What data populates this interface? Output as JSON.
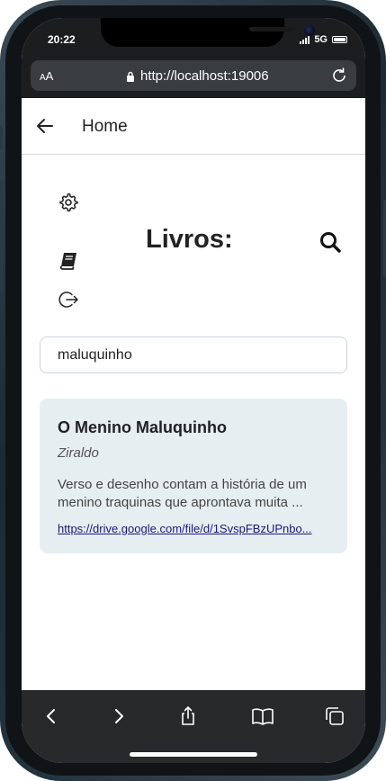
{
  "status_bar": {
    "time": "20:22",
    "network": "5G"
  },
  "browser": {
    "text_size_label_small": "A",
    "text_size_label_large": "A",
    "url": "http://localhost:19006"
  },
  "app_bar": {
    "title": "Home"
  },
  "page": {
    "heading": "Livros:",
    "icons": [
      "gear-icon",
      "book-icon",
      "logout-icon",
      "search-icon"
    ]
  },
  "search": {
    "value": "maluquinho",
    "placeholder": ""
  },
  "results": [
    {
      "title": "O Menino Maluquinho",
      "author": "Ziraldo",
      "description": "Verso e desenho contam a história de um menino traquinas que aprontava muita ...",
      "link": "https://drive.google.com/file/d/1SvspFBzUPnbo..."
    }
  ],
  "bottom_toolbar": {
    "icons": [
      "back-icon",
      "forward-icon",
      "share-icon",
      "bookmarks-icon",
      "tabs-icon"
    ]
  },
  "colors": {
    "card_background": "#e6eef1",
    "chrome_dark": "#27292b",
    "link": "#1a1a7a"
  }
}
